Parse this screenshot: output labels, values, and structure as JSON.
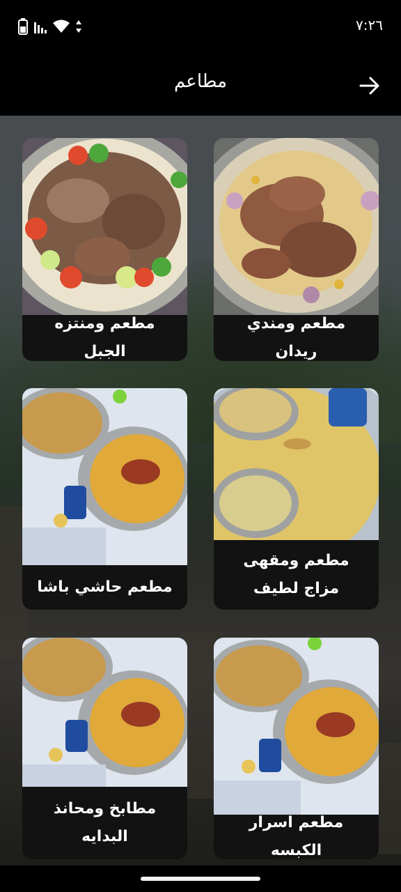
{
  "status_bar": {
    "time": "٧:٢٦",
    "icons": [
      "battery-icon",
      "signal-icon",
      "wifi-icon",
      "data-arrows-icon"
    ]
  },
  "app_bar": {
    "title": "مطاعم",
    "back_icon": "arrow-right-icon"
  },
  "restaurants": [
    {
      "name": "مطعم ومندي ريدان",
      "image": "mandi-rice-with-lamb"
    },
    {
      "name": "مطعم ومنتزه الجبل",
      "image": "grilled-lamb-platter"
    },
    {
      "name": "مطعم ومقهى مزاج لطيف",
      "image": "rice-with-soup-bowls"
    },
    {
      "name": "مطعم حاشي باشا",
      "image": "kabsa-plates-on-table"
    },
    {
      "name": "مطعم اسرار الكبسه",
      "image": "kabsa-plates-on-table"
    },
    {
      "name": "مطابخ ومحانذ البدايه",
      "image": "kabsa-plates-on-table"
    }
  ],
  "colors": {
    "bar_background": "#000000",
    "card_background": "#121212",
    "text": "#ffffff"
  }
}
